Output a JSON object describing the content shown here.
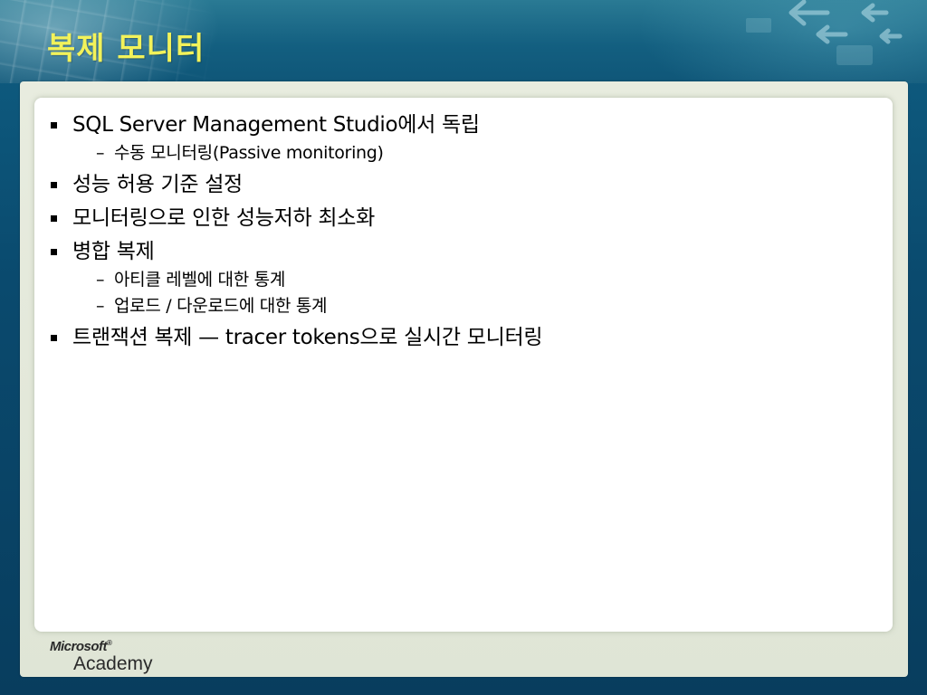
{
  "slide": {
    "title": "복제 모니터",
    "bullets": [
      {
        "text": "SQL Server Management Studio에서 독립",
        "subs": [
          "수동 모니터링(Passive monitoring)"
        ]
      },
      {
        "text": "성능 허용 기준 설정",
        "subs": []
      },
      {
        "text": "모니터링으로 인한 성능저하 최소화",
        "subs": []
      },
      {
        "text": "병합 복제",
        "subs": [
          "아티클 레벨에 대한 통계",
          "업로드 / 다운로드에 대한 통계"
        ]
      },
      {
        "text": "트랜잭션 복제 — tracer tokens으로 실시간 모니터링",
        "subs": []
      }
    ],
    "sub_dash": "–"
  },
  "footer": {
    "logo_microsoft": "Microsoft",
    "logo_reg": "®",
    "logo_academy": "Academy"
  },
  "colors": {
    "title": "#f2f25a",
    "background": "#0a4a6e",
    "frame": "#e4e9dc",
    "content": "#ffffff"
  },
  "icons": [
    "bullet-square-icon",
    "arrow-left-icon"
  ]
}
